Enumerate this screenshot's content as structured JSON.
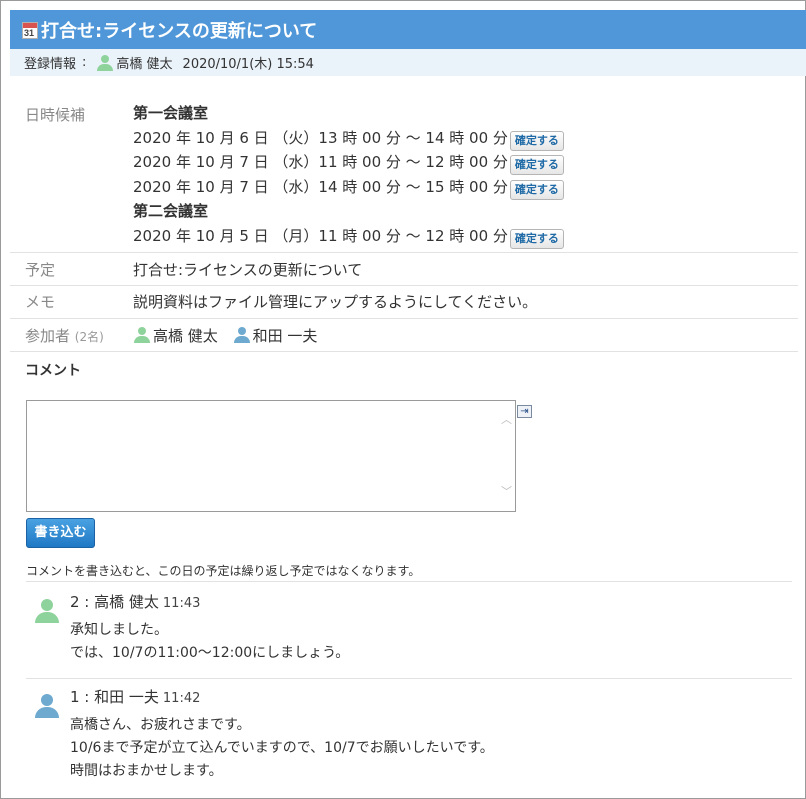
{
  "header": {
    "title": "打合せ:ライセンスの更新について",
    "calendar_icon_text": "31"
  },
  "meta": {
    "label": "登録情報",
    "separator": ":",
    "author": "高橋 健太",
    "datetime": "2020/10/1(木) 15:54"
  },
  "candidates": {
    "label": "日時候補",
    "confirm_label": "確定する",
    "rooms": [
      {
        "name": "第一会議室",
        "slots": [
          "2020 年 10 月 6 日 （火）13 時 00 分 ～ 14 時 00 分",
          "2020 年 10 月 7 日 （水）11 時 00 分 ～ 12 時 00 分",
          "2020 年 10 月 7 日 （水）14 時 00 分 ～ 15 時 00 分"
        ]
      },
      {
        "name": "第二会議室",
        "slots": [
          "2020 年 10 月 5 日 （月）11 時 00 分 ～ 12 時 00 分"
        ]
      }
    ]
  },
  "schedule": {
    "label": "予定",
    "value": "打合せ:ライセンスの更新について"
  },
  "memo": {
    "label": "メモ",
    "value": "説明資料はファイル管理にアップするようにしてください。"
  },
  "participants": {
    "label": "参加者",
    "count": "(2名)",
    "members": [
      "高橋 健太",
      "和田 一夫"
    ]
  },
  "comment_section": {
    "heading": "コメント",
    "textarea_value": "",
    "submit_label": "書き込む",
    "note": "コメントを書き込むと、この日の予定は繰り返し予定ではなくなります。"
  },
  "comments": [
    {
      "number_author": "2 : 高橋 健太",
      "time": "11:43",
      "lines": [
        "承知しました。",
        "では、10/7の11:00～12:00にしましょう。"
      ],
      "avatar_color": "#8fd39c"
    },
    {
      "number_author": "1 : 和田 一夫",
      "time": "11:42",
      "lines": [
        "高橋さん、お疲れさまです。",
        "10/6まで予定が立て込んでいますので、10/7でお願いしたいです。",
        "時間はおまかせします。"
      ],
      "avatar_color": "#6ea9cf"
    }
  ]
}
